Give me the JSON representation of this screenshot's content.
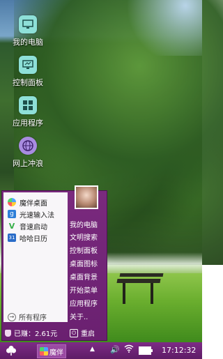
{
  "desktop": {
    "icons": [
      {
        "label": "我的电脑",
        "icon": "computer-icon",
        "color": "#8ee0d8"
      },
      {
        "label": "控制面板",
        "icon": "control-panel-icon",
        "color": "#8ee0d8"
      },
      {
        "label": "应用程序",
        "icon": "apps-icon",
        "color": "#8ee0d8"
      },
      {
        "label": "网上冲浪",
        "icon": "globe-icon",
        "color": "#a88ce0"
      }
    ]
  },
  "start_menu": {
    "pinned": [
      {
        "label": "魔伴桌面",
        "icon": "mobao-desktop-icon",
        "color": "#4fa3ff"
      },
      {
        "label": "光速输入法",
        "icon": "input-method-icon",
        "color": "#2f7fd8"
      },
      {
        "label": "音速启动",
        "icon": "quick-launch-icon",
        "color": "#38b04a"
      },
      {
        "label": "哈哈日历",
        "icon": "calendar-icon",
        "color": "#2a6cc8"
      }
    ],
    "all_programs": "所有程序",
    "right_links": [
      "我的电脑",
      "文明搜索",
      "控制面板",
      "桌面图标",
      "桌面背景",
      "开始菜单",
      "应用程序",
      "关于.."
    ],
    "earnings": "已赚：2.61元",
    "restart": "重启"
  },
  "taskbar": {
    "task_label": "魔伴",
    "clock": "17:12:32",
    "accent": "#6a2070"
  }
}
